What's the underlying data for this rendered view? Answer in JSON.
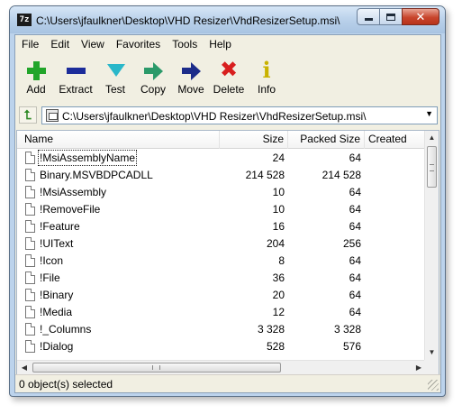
{
  "window": {
    "app_icon_text": "7z",
    "title": "C:\\Users\\jfaulkner\\Desktop\\VHD Resizer\\VhdResizerSetup.msi\\"
  },
  "menu": [
    "File",
    "Edit",
    "View",
    "Favorites",
    "Tools",
    "Help"
  ],
  "toolbar": {
    "add": "Add",
    "extract": "Extract",
    "test": "Test",
    "copy": "Copy",
    "move": "Move",
    "delete": "Delete",
    "info": "Info"
  },
  "address": {
    "path": "C:\\Users\\jfaulkner\\Desktop\\VHD Resizer\\VhdResizerSetup.msi\\"
  },
  "list": {
    "columns": {
      "name": "Name",
      "size": "Size",
      "packed": "Packed Size",
      "created": "Created"
    },
    "rows": [
      {
        "name": "!MsiAssemblyName",
        "size": "24",
        "packed": "64"
      },
      {
        "name": "Binary.MSVBDPCADLL",
        "size": "214 528",
        "packed": "214 528"
      },
      {
        "name": "!MsiAssembly",
        "size": "10",
        "packed": "64"
      },
      {
        "name": "!RemoveFile",
        "size": "10",
        "packed": "64"
      },
      {
        "name": "!Feature",
        "size": "16",
        "packed": "64"
      },
      {
        "name": "!UIText",
        "size": "204",
        "packed": "256"
      },
      {
        "name": "!Icon",
        "size": "8",
        "packed": "64"
      },
      {
        "name": "!File",
        "size": "36",
        "packed": "64"
      },
      {
        "name": "!Binary",
        "size": "20",
        "packed": "64"
      },
      {
        "name": "!Media",
        "size": "12",
        "packed": "64"
      },
      {
        "name": "!_Columns",
        "size": "3 328",
        "packed": "3 328"
      },
      {
        "name": "!Dialog",
        "size": "528",
        "packed": "576"
      }
    ]
  },
  "status": {
    "text": "0 object(s) selected"
  },
  "glyphs": {
    "close": "✕",
    "up_arrow": "▲",
    "down_arrow": "▼",
    "left_arrow": "◀",
    "right_arrow": "▶",
    "delete": "✖",
    "info": "i",
    "up_folder": "⮤",
    "dropdown": "▼"
  }
}
